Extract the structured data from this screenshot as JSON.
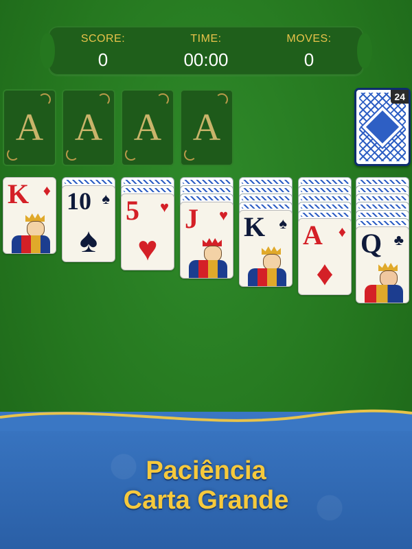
{
  "stats": {
    "score_label": "SCORE:",
    "score_value": "0",
    "time_label": "TIME:",
    "time_value": "00:00",
    "moves_label": "MOVES:",
    "moves_value": "0"
  },
  "foundations": [
    "A",
    "A",
    "A",
    "A"
  ],
  "stock": {
    "count": "24"
  },
  "tableau": [
    {
      "rank": "K",
      "suit": "♦",
      "color": "red"
    },
    {
      "rank": "10",
      "suit": "♠",
      "color": "black"
    },
    {
      "rank": "5",
      "suit": "♥",
      "color": "red"
    },
    {
      "rank": "J",
      "suit": "♥",
      "color": "red"
    },
    {
      "rank": "K",
      "suit": "♠",
      "color": "black"
    },
    {
      "rank": "A",
      "suit": "♦",
      "color": "red"
    },
    {
      "rank": "Q",
      "suit": "♣",
      "color": "black"
    }
  ],
  "promo": {
    "line1": "Paciência",
    "line2": "Carta Grande"
  },
  "colors": {
    "felt": "#25771f",
    "gold": "#f6c93c",
    "banner": "#2a5fa6"
  }
}
